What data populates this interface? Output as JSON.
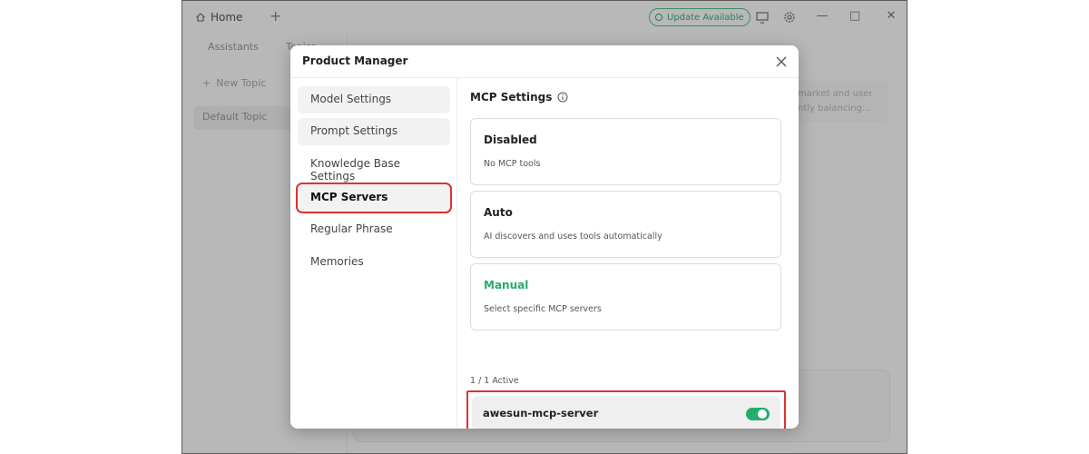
{
  "titlebar": {
    "home_tab_label": "Home",
    "update_label": "Update Available"
  },
  "left_pane": {
    "tabs": [
      "Assistants",
      "Topics"
    ],
    "new_topic_label": "New Topic",
    "default_topic_label": "Default Topic"
  },
  "background": {
    "hint_text": "market and user ntly balancing..."
  },
  "modal": {
    "title": "Product Manager",
    "menu": [
      {
        "label": "Model Settings"
      },
      {
        "label": "Prompt Settings"
      },
      {
        "label": "Knowledge Base Settings"
      },
      {
        "label": "MCP Servers"
      },
      {
        "label": "Regular Phrase"
      },
      {
        "label": "Memories"
      }
    ],
    "active_menu_item": "MCP Servers",
    "section_title": "MCP Settings",
    "options": [
      {
        "title": "Disabled",
        "description": "No MCP tools"
      },
      {
        "title": "Auto",
        "description": "AI discovers and uses tools automatically"
      },
      {
        "title": "Manual",
        "description": "Select specific MCP servers"
      }
    ],
    "selected_option": "Manual",
    "active_count": "1 / 1 Active",
    "servers": [
      {
        "name": "awesun-mcp-server",
        "enabled": true
      }
    ]
  },
  "colors": {
    "accent_green": "#23ad6a",
    "highlight_red": "#e03131"
  }
}
